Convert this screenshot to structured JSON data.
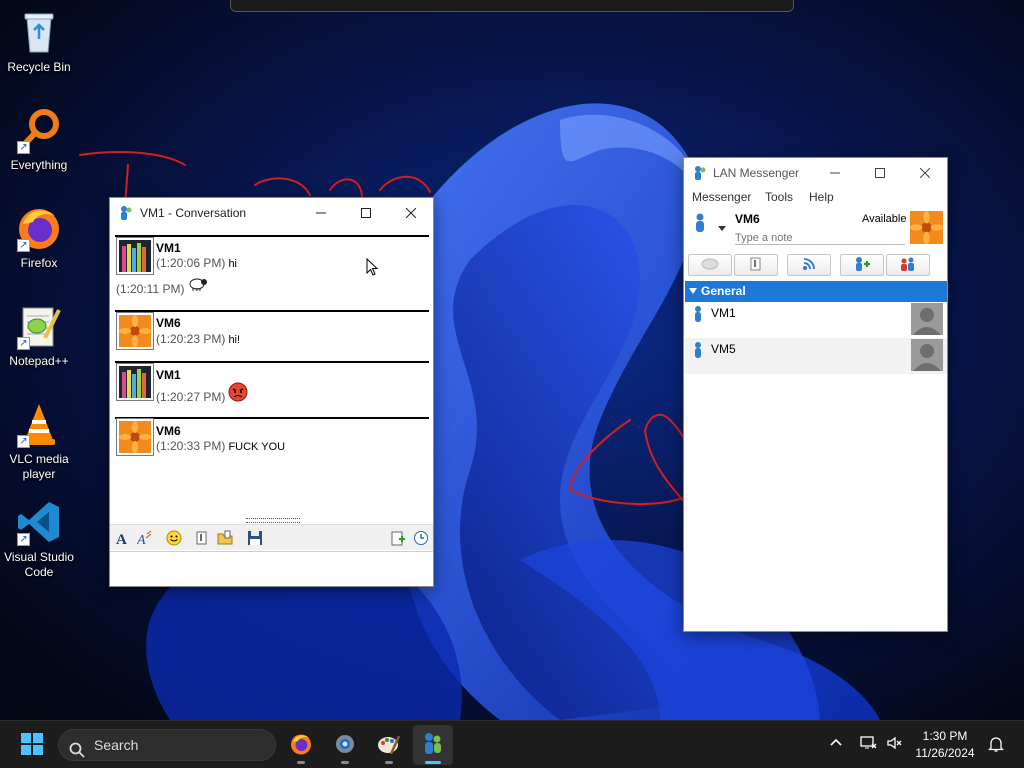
{
  "desktop": {
    "icons": [
      {
        "label": "Recycle Bin",
        "icon": "recycle-bin-icon"
      },
      {
        "label": "Everything",
        "icon": "everything-search-icon"
      },
      {
        "label": "Firefox",
        "icon": "firefox-icon"
      },
      {
        "label": "Notepad++",
        "icon": "notepad-plus-plus-icon"
      },
      {
        "label": "VLC media player",
        "icon": "vlc-icon"
      },
      {
        "label": "Visual Studio Code",
        "icon": "vscode-icon"
      }
    ]
  },
  "conversation": {
    "title": "VM1 - Conversation",
    "messages": [
      {
        "sender": "VM1",
        "time": "(1:20:06 PM)",
        "text": "hi"
      },
      {
        "sender": "",
        "time": "(1:20:11 PM)",
        "text": "",
        "emoticon": "sheep-emoticon"
      },
      {
        "sender": "VM6",
        "time": "(1:20:23 PM)",
        "text": "hi!"
      },
      {
        "sender": "VM1",
        "time": "(1:20:27 PM)",
        "text": "",
        "emoticon": "angry-face-emoticon"
      },
      {
        "sender": "VM6",
        "time": "(1:20:33 PM)",
        "text": "FUCK YOU"
      }
    ],
    "toolbar_icons": [
      "font-icon",
      "font-style-icon",
      "smiley-icon",
      "send-file-icon",
      "send-folder-icon",
      "save-icon",
      "export-icon",
      "history-icon"
    ]
  },
  "lan": {
    "title": "LAN Messenger",
    "menu": [
      "Messenger",
      "Tools",
      "Help"
    ],
    "user": {
      "name": "VM6",
      "status": "Available",
      "note_placeholder": "Type a note"
    },
    "buttons": [
      "chat-icon",
      "send-file-icon",
      "broadcast-icon",
      "add-contact-icon",
      "group-icon"
    ],
    "group": "General",
    "contacts": [
      {
        "name": "VM1"
      },
      {
        "name": "VM5"
      }
    ]
  },
  "taskbar": {
    "search_placeholder": "Search",
    "apps": [
      "firefox-icon",
      "settings-icon",
      "paint-icon",
      "lan-messenger-icon"
    ],
    "time": "1:30 PM",
    "date": "11/26/2024"
  },
  "colors": {
    "accent": "#1e78d7",
    "wallpaper": "#050b26",
    "taskbar": "#1c1c1c",
    "annotation": "#d21f1f"
  }
}
